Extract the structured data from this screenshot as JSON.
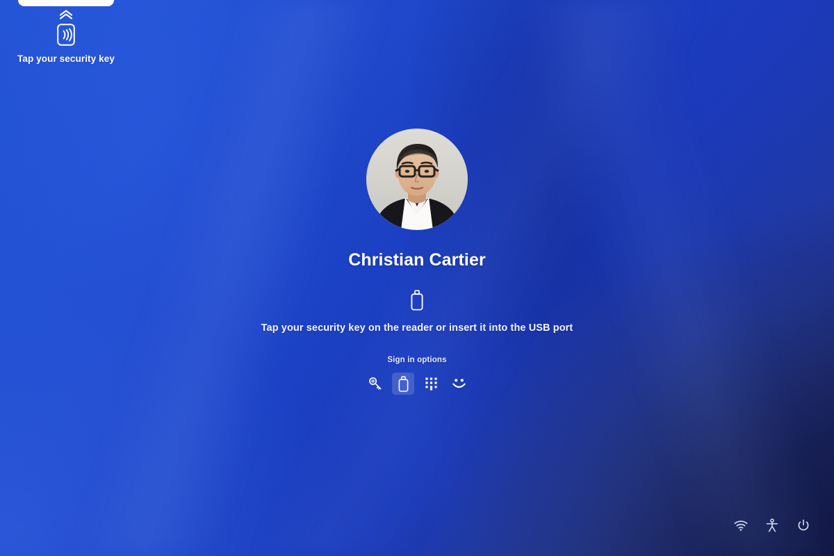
{
  "screen": {
    "name": "windows-lock-screen",
    "background_colors": {
      "blue_mid": "#1c41c4",
      "blue_light": "#2454d6",
      "blue_dark_corner": "#222c63",
      "accent_white": "#ffffff"
    }
  },
  "notification": {
    "collapse_icon": "chevron-double-up-icon",
    "icon": "nfc-contactless-icon",
    "label": "Tap your security key"
  },
  "user": {
    "avatar_icon": "user-avatar-photo",
    "display_name": "Christian Cartier"
  },
  "prompt": {
    "icon": "usb-security-key-icon",
    "instruction": "Tap your security key on the reader or insert it into the USB port"
  },
  "signin_options": {
    "label": "Sign in options",
    "items": [
      {
        "name": "password-option",
        "icon": "key-icon",
        "title": "Password",
        "selected": false
      },
      {
        "name": "security-key-option",
        "icon": "usb-security-key-icon",
        "title": "Security key",
        "selected": true
      },
      {
        "name": "pin-option",
        "icon": "pin-keypad-icon",
        "title": "PIN",
        "selected": false
      },
      {
        "name": "facial-recognition-option",
        "icon": "face-smile-icon",
        "title": "Facial recognition",
        "selected": false
      }
    ]
  },
  "system_tray": {
    "items": [
      {
        "name": "network-button",
        "icon": "wifi-icon",
        "title": "Network"
      },
      {
        "name": "accessibility-button",
        "icon": "accessibility-icon",
        "title": "Accessibility"
      },
      {
        "name": "power-button",
        "icon": "power-icon",
        "title": "Power"
      }
    ]
  }
}
